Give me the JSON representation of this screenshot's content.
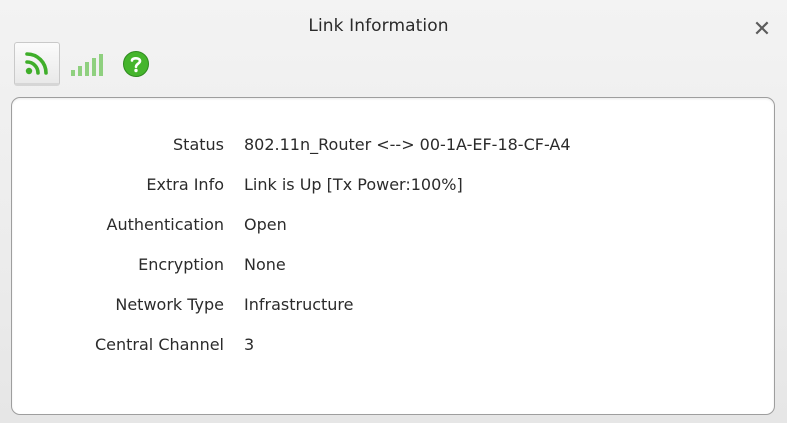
{
  "window": {
    "title": "Link Information",
    "close_symbol": "✕"
  },
  "toolbar": {
    "tabs": [
      {
        "name": "link-status",
        "icon": "wifi-signal-icon",
        "active": true
      },
      {
        "name": "signal-strength",
        "icon": "signal-bars-icon",
        "active": false
      },
      {
        "name": "help",
        "icon": "help-icon",
        "active": false
      }
    ]
  },
  "info": {
    "rows": [
      {
        "label": "Status",
        "value": "802.11n_Router <--> 00-1A-EF-18-CF-A4"
      },
      {
        "label": "Extra Info",
        "value": "Link is Up  [Tx Power:100%]"
      },
      {
        "label": "Authentication",
        "value": "Open"
      },
      {
        "label": "Encryption",
        "value": "None"
      },
      {
        "label": "Network Type",
        "value": "Infrastructure"
      },
      {
        "label": "Central Channel",
        "value": "3"
      }
    ]
  },
  "colors": {
    "accent_green": "#3fae2a",
    "window_bg": "#ececec",
    "panel_bg": "#ffffff"
  }
}
